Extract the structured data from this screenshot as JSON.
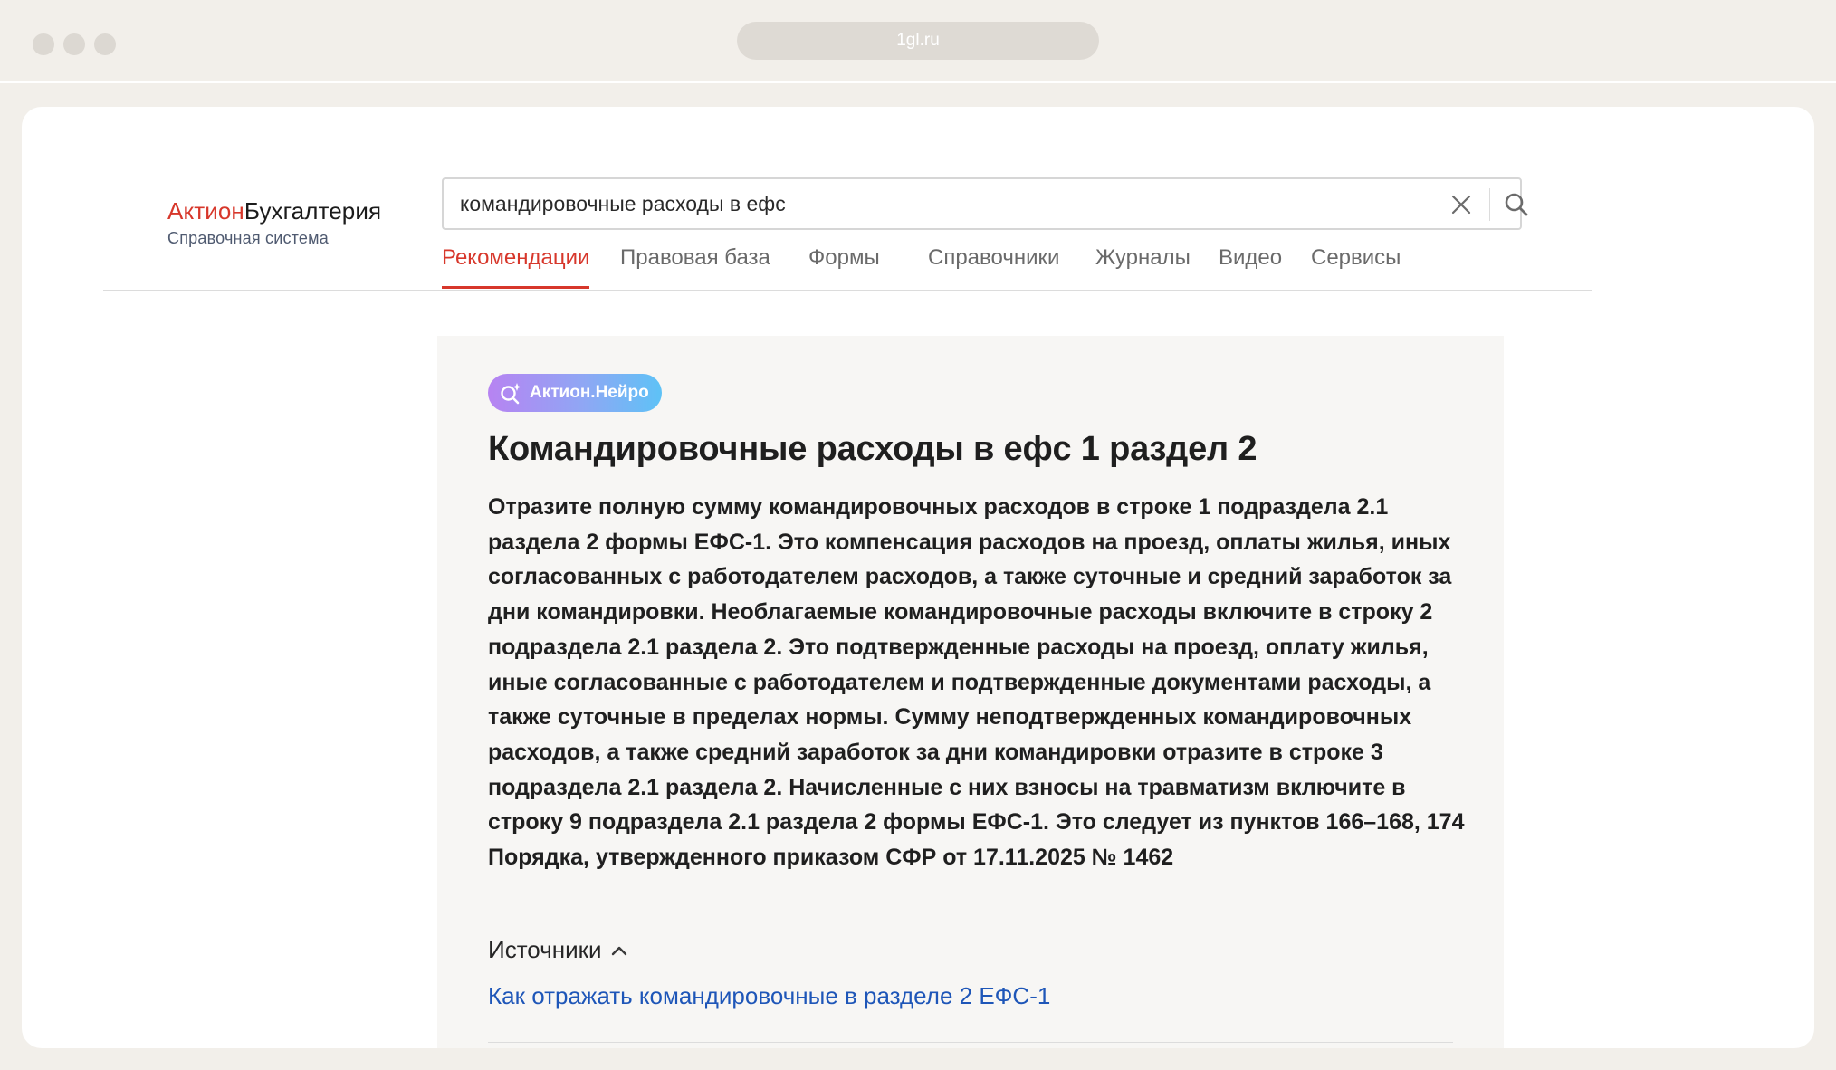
{
  "browser": {
    "url": "1gl.ru"
  },
  "logo": {
    "brand_red": "Актион",
    "brand_black": "Бухгалтерия",
    "subtitle": "Справочная система"
  },
  "search": {
    "value": "командировочные расходы в ефс"
  },
  "tabs": [
    {
      "label": "Рекомендации",
      "active": true
    },
    {
      "label": "Правовая база",
      "active": false
    },
    {
      "label": "Формы",
      "active": false
    },
    {
      "label": "Справочники",
      "active": false
    },
    {
      "label": "Журналы",
      "active": false
    },
    {
      "label": "Видео",
      "active": false
    },
    {
      "label": "Сервисы",
      "active": false
    }
  ],
  "card": {
    "badge": "Актион.Нейро",
    "title": "Командировочные расходы в ефс 1 раздел 2",
    "answer": "Отразите полную сумму командировочных расходов в строке 1 подраздела 2.1 раздела 2 формы ЕФС-1. Это компенсация расходов на проезд, оплаты жилья, иных согласованных с работодателем расходов, а также суточные и средний заработок за дни командировки. Необлагаемые командировочные расходы включите в строку 2 подраздела 2.1 раздела 2. Это подтвержденные расходы на проезд, оплату жилья, иные согласованные с работодателем и подтвержденные документами расходы, а также суточные в пределах нормы. Сумму неподтвержденных командировочных расходов, а также средний заработок за дни командировки отразите в строке 3 подраздела 2.1 раздела 2. Начисленные с них взносы на травматизм включите в строку 9 подраздела 2.1 раздела 2 формы ЕФС-1. Это следует из пунктов 166–168, 174 Порядка, утвержденного приказом СФР от 17.11.2025 № 1462",
    "sources_label": "Источники",
    "sources": [
      {
        "label": "Как отражать командировочные в разделе 2 ЕФС-1"
      }
    ]
  },
  "icons": {
    "clear": "close-icon",
    "search": "search-icon",
    "badge": "ai-search-icon",
    "sources_toggle": "chevron-up-icon"
  },
  "colors": {
    "accent_red": "#d7372b",
    "link_blue": "#1e56b8",
    "card_bg": "#f7f6f4",
    "page_bg": "#f2efea"
  }
}
